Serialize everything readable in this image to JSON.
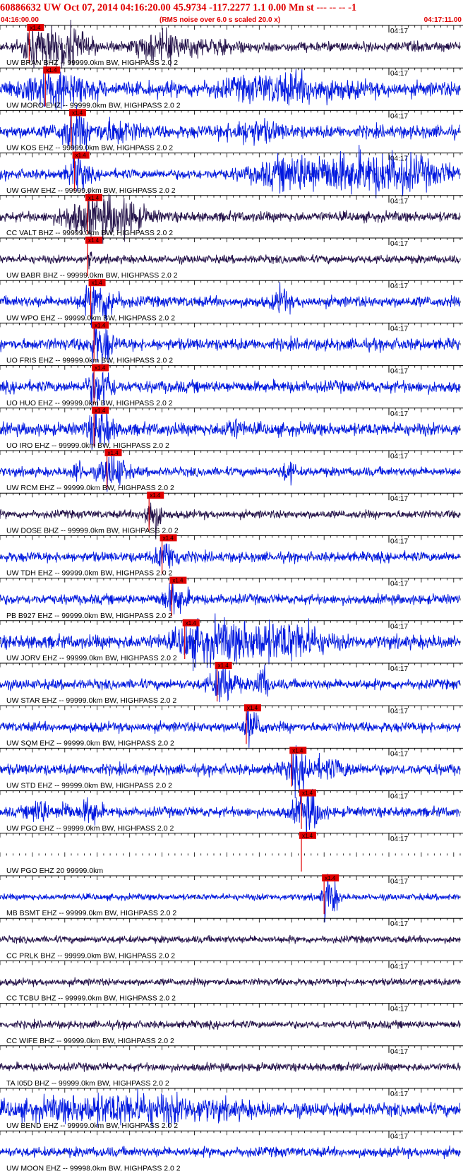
{
  "header": {
    "title": "60886632 UW Oct 07, 2014 04:16:20.00   45.9734 -117.2277  1.1 0.00 Mn st --- -- --  -1",
    "start_time": "04:16:00.00",
    "note": "(RMS noise over 6.0 s scaled 20.0 x)",
    "end_time": "04:17:11.00"
  },
  "chart_data": {
    "type": "line",
    "title": "60886632 UW Oct 07, 2014 04:16:20.00   45.9734 -117.2277  1.1 0.00 Mn st --- -- --  -1",
    "time_range": [
      "04:16:00.00",
      "04:17:11.00"
    ],
    "minute_label": "04:17",
    "pick_label": "x1.4",
    "colors": {
      "blue": "#0018e0",
      "dark": "#24124a",
      "pick": "#e00000",
      "axis": "#000000",
      "label": "#000000"
    },
    "traces": [
      {
        "label": "UW BRAN BHZ -- 99999.0km BW, HIGHPASS  2.0  2",
        "color": "dark",
        "pick_s": 4.5,
        "amp": 0.22,
        "events": [
          [
            9.5,
            3.5,
            1.0
          ],
          [
            4.5,
            1.0,
            0.7
          ],
          [
            23,
            2,
            0.35
          ],
          [
            26,
            1.5,
            0.3
          ],
          [
            30,
            6,
            0.25
          ]
        ]
      },
      {
        "label": "UW MORO EHZ -- 99999.0km BW, HIGHPASS  2.0  2",
        "color": "blue",
        "pick_s": 7.0,
        "amp": 0.32,
        "events": [
          [
            8.5,
            5.0,
            0.7
          ],
          [
            44,
            9,
            0.45
          ]
        ]
      },
      {
        "label": "UW KOS EHZ -- 99999.0km BW, HIGHPASS  2.0  2",
        "color": "blue",
        "pick_s": 11.0,
        "amp": 0.28,
        "events": [
          [
            11.5,
            2.0,
            0.8
          ],
          [
            18,
            3,
            0.4
          ],
          [
            39,
            4,
            0.35
          ]
        ]
      },
      {
        "label": "UW GHW EHZ -- 99999.0km BW, HIGHPASS  2.0  2",
        "color": "blue",
        "pick_s": 11.5,
        "amp": 0.22,
        "events": [
          [
            12,
            1.5,
            0.7
          ],
          [
            45,
            6,
            0.5
          ],
          [
            58,
            10,
            0.85
          ]
        ]
      },
      {
        "label": "CC VALT BHZ -- 99999.0km BW, HIGHPASS  2.0  2",
        "color": "dark",
        "pick_s": 13.5,
        "amp": 0.22,
        "events": [
          [
            17,
            4.5,
            1.0
          ],
          [
            11,
            2,
            0.35
          ]
        ]
      },
      {
        "label": "UW BABR BHZ -- 99999.0km BW, HIGHPASS  2.0  2",
        "color": "dark",
        "pick_s": 13.5,
        "amp": 0.18,
        "events": []
      },
      {
        "label": "UW WPO EHZ -- 99999.0km BW, HIGHPASS  2.0  2",
        "color": "blue",
        "pick_s": 14.0,
        "amp": 0.24,
        "events": [
          [
            15.5,
            2.5,
            0.75
          ],
          [
            43.5,
            1.2,
            0.5
          ]
        ]
      },
      {
        "label": "UO FRIS EHZ -- 99999.0km BW, HIGHPASS  2.0  2",
        "color": "blue",
        "pick_s": 14.5,
        "amp": 0.26,
        "events": [
          [
            15.5,
            1.6,
            1.0
          ]
        ]
      },
      {
        "label": "UO HUO EHZ -- 99999.0km BW, HIGHPASS  2.0  2",
        "color": "blue",
        "pick_s": 14.5,
        "amp": 0.26,
        "events": [
          [
            15.5,
            1.6,
            1.0
          ]
        ]
      },
      {
        "label": "UO IRO EHZ -- 99999.0km BW, HIGHPASS  2.0  2",
        "color": "blue",
        "pick_s": 14.5,
        "amp": 0.28,
        "events": [
          [
            15.5,
            1.6,
            1.0
          ],
          [
            36,
            1.5,
            0.3
          ]
        ]
      },
      {
        "label": "UW RCM EHZ -- 99999.0km BW, HIGHPASS  2.0  2",
        "color": "blue",
        "pick_s": 16.5,
        "amp": 0.2,
        "events": [
          [
            17.5,
            2.0,
            0.7
          ],
          [
            12,
            1.0,
            0.4
          ],
          [
            44.5,
            1.0,
            0.4
          ]
        ]
      },
      {
        "label": "UW DOSE BHZ -- 99999.0km BW, HIGHPASS  2.0  2",
        "color": "dark",
        "pick_s": 23.0,
        "amp": 0.18,
        "events": [
          [
            23.5,
            1.2,
            0.9
          ]
        ]
      },
      {
        "label": "UW TDH EHZ -- 99999.0km BW, HIGHPASS  2.0  2",
        "color": "blue",
        "pick_s": 25.0,
        "amp": 0.22,
        "events": [
          [
            26,
            2.0,
            0.5
          ]
        ]
      },
      {
        "label": "PB B927 EHZ -- 99999.0km BW, HIGHPASS  2.0  2",
        "color": "blue",
        "pick_s": 26.5,
        "amp": 0.22,
        "events": [
          [
            27,
            2.0,
            0.55
          ]
        ]
      },
      {
        "label": "UW JORV EHZ -- 99999.0km BW, HIGHPASS  2.0  2",
        "color": "blue",
        "pick_s": 28.5,
        "amp": 0.3,
        "events": [
          [
            37,
            7,
            1.0
          ],
          [
            30,
            2,
            0.8
          ],
          [
            46,
            4,
            0.55
          ]
        ]
      },
      {
        "label": "UW STAR EHZ -- 99999.0km BW, HIGHPASS  2.0  2",
        "color": "blue",
        "pick_s": 33.5,
        "amp": 0.22,
        "events": [
          [
            34.5,
            2.0,
            0.75
          ],
          [
            40.5,
            1.0,
            0.7
          ]
        ]
      },
      {
        "label": "UW SQM EHZ -- 99999.0km BW, HIGHPASS  2.0  2",
        "color": "blue",
        "pick_s": 38.0,
        "amp": 0.22,
        "events": [
          [
            39,
            1.5,
            0.5
          ]
        ]
      },
      {
        "label": "UW STD EHZ -- 99999.0km BW, HIGHPASS  2.0  2",
        "color": "blue",
        "pick_s": 45.0,
        "amp": 0.24,
        "events": [
          [
            46,
            2.0,
            0.45
          ],
          [
            50,
            4,
            0.3
          ]
        ]
      },
      {
        "label": "UW PGO EHZ -- 99999.0km BW, HIGHPASS  2.0  2",
        "color": "blue",
        "pick_s": 46.5,
        "amp": 0.22,
        "events": [
          [
            47.5,
            2.0,
            0.85
          ],
          [
            6,
            1.5,
            0.45
          ],
          [
            14,
            1.5,
            0.5
          ],
          [
            10,
            1.0,
            0.35
          ]
        ]
      },
      {
        "label": "UW PGO EHZ 20 99999.0km",
        "color": "blue",
        "pick_s": 46.5,
        "amp": 0.0,
        "events": []
      },
      {
        "label": "MB BSMT EHZ -- 99999.0km BW, HIGHPASS  2.0  2",
        "color": "blue",
        "pick_s": 50.0,
        "amp": 0.14,
        "events": [
          [
            51,
            1.2,
            0.8
          ]
        ]
      },
      {
        "label": "CC PRLK BHZ -- 99999.0km BW, HIGHPASS  2.0  2",
        "color": "dark",
        "pick_s": null,
        "amp": 0.16,
        "events": []
      },
      {
        "label": "CC TCBU BHZ -- 99999.0km BW, HIGHPASS  2.0  2",
        "color": "dark",
        "pick_s": null,
        "amp": 0.16,
        "events": []
      },
      {
        "label": "CC WIFE BHZ -- 99999.0km BW, HIGHPASS  2.0  2",
        "color": "dark",
        "pick_s": null,
        "amp": 0.17,
        "events": []
      },
      {
        "label": "TA I05D BHZ -- 99999.0km BW, HIGHPASS  2.0  2",
        "color": "dark",
        "pick_s": null,
        "amp": 0.18,
        "events": []
      },
      {
        "label": "UW BEND EHZ -- 99999.0km BW, HIGHPASS  2.0  2",
        "color": "blue",
        "pick_s": null,
        "amp": 0.28,
        "events": [
          [
            20,
            16,
            0.5
          ]
        ]
      },
      {
        "label": "UW MOON EHZ -- 99998.0km BW, HIGHPASS  2.0  2",
        "color": "blue",
        "pick_s": null,
        "amp": 0.22,
        "events": []
      }
    ]
  }
}
